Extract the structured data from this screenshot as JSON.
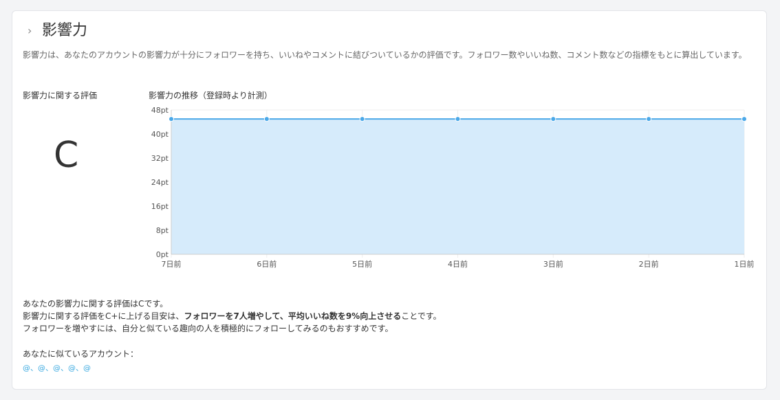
{
  "header": {
    "chevron": "›",
    "title": "影響力"
  },
  "description": "影響力は、あなたのアカウントの影響力が十分にフォロワーを持ち、いいねやコメントに結びついているかの評価です。フォロワー数やいいね数、コメント数などの指標をもとに算出しています。",
  "grade_section": {
    "label": "影響力に関する評価",
    "grade": "C"
  },
  "chart_section": {
    "title": "影響力の推移（登録時より計測）"
  },
  "chart_data": {
    "type": "area",
    "categories": [
      "7日前",
      "6日前",
      "5日前",
      "4日前",
      "3日前",
      "2日前",
      "1日前"
    ],
    "values": [
      45,
      45,
      45,
      45,
      45,
      45,
      45
    ],
    "yticks": [
      "0pt",
      "8pt",
      "16pt",
      "24pt",
      "32pt",
      "40pt",
      "48pt"
    ],
    "ylim": [
      0,
      48
    ],
    "line_color": "#4aa8e8",
    "fill_color": "#d6ebfb",
    "grid": true
  },
  "summary": {
    "line1": "あなたの影響力に関する評価はCです。",
    "line2_prefix": "影響力に関する評価をC+に上げる目安は、",
    "line2_bold": "フォロワーを7人増やして、平均いいね数を9%向上させる",
    "line2_suffix": "ことです。",
    "line3": "フォロワーを増やすには、自分と似ている趣向の人を積極的にフォローしてみるのもおすすめです。"
  },
  "similar": {
    "label": "あなたに似ているアカウント：",
    "accounts": [
      "@",
      "@",
      "@",
      "@",
      "@"
    ],
    "separator": "、"
  }
}
